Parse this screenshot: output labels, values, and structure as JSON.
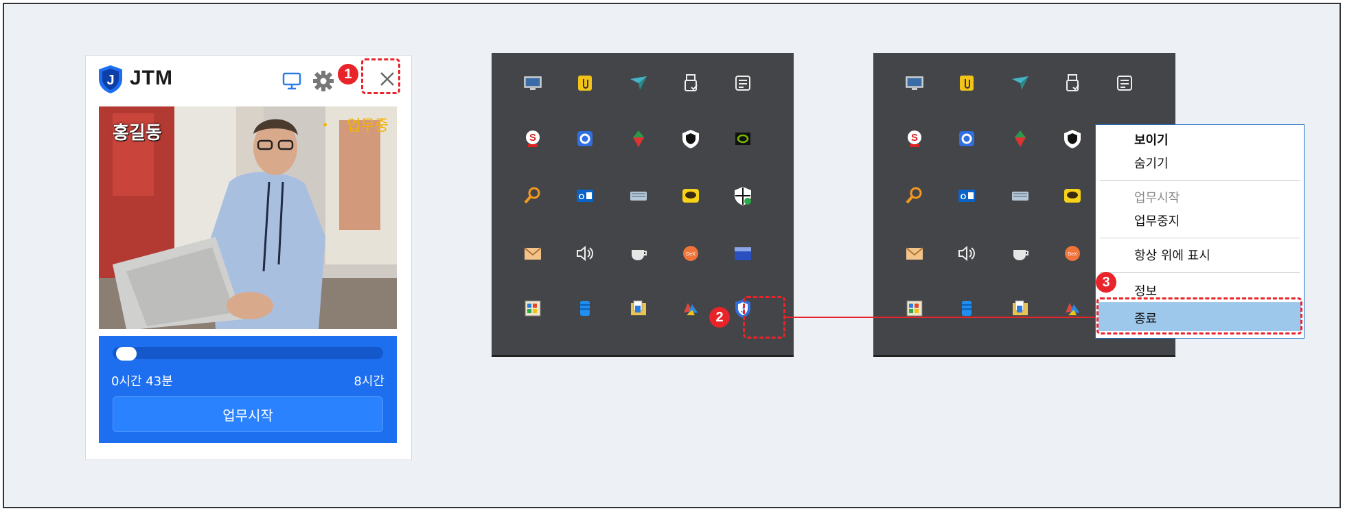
{
  "widget": {
    "title": "JTM",
    "user_name": "홍길동",
    "status": "업무중",
    "progress": {
      "fraction": 0.09,
      "elapsed": "0시간 43분",
      "target": "8시간"
    },
    "start_button": "업무시작"
  },
  "tray": {
    "icons": [
      [
        "monitor-icon",
        "clip-icon",
        "plane-icon",
        "usb-icon",
        "notes-icon"
      ],
      [
        "s-badge-icon",
        "shield-circle-icon",
        "leaf-icon",
        "shield-dark-icon",
        "nvidia-icon"
      ],
      [
        "magnifier-icon",
        "outlook-icon",
        "keyboard-icon",
        "chat-icon",
        "security-icon"
      ],
      [
        "mail-icon",
        "speaker-icon",
        "cup-icon",
        "dex-icon",
        "battery-icon"
      ],
      [
        "board-icon",
        "db-icon",
        "folder-icon",
        "office-icon",
        "jtm-shield-icon"
      ]
    ]
  },
  "context_menu": {
    "items": [
      "보이기",
      "숨기기",
      "업무시작",
      "업무중지",
      "항상 위에 표시",
      "정보",
      "종료"
    ]
  },
  "callouts": [
    "1",
    "2",
    "3"
  ],
  "colors": {
    "accent": "#1e6ff0",
    "callout": "#e8232a",
    "menu_highlight": "#9ec7ec",
    "status": "#f5b400"
  }
}
